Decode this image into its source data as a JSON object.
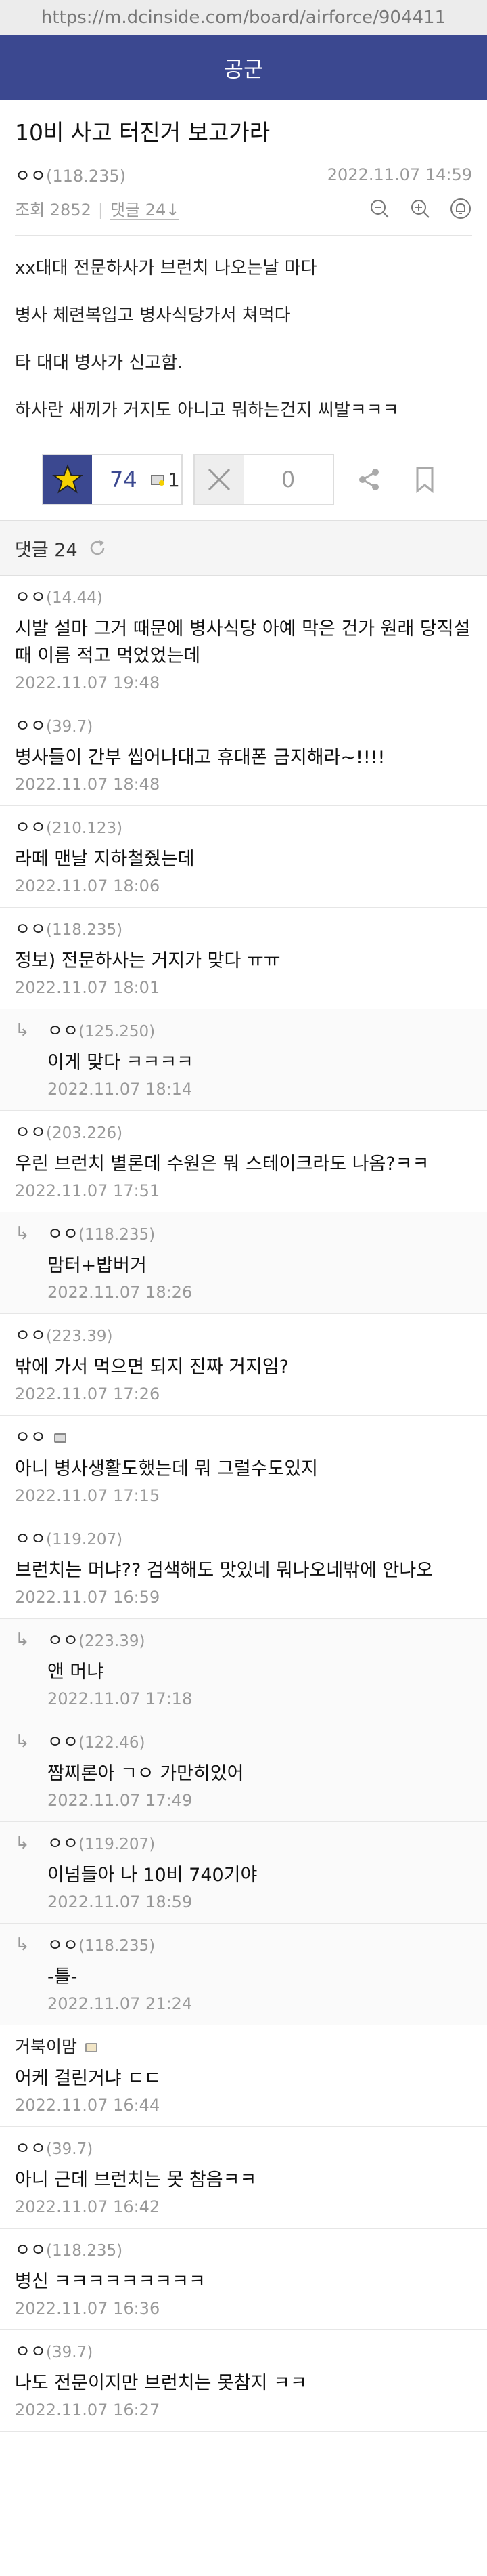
{
  "browser": {
    "url": "https://m.dcinside.com/board/airforce/904411"
  },
  "header": {
    "title": "공군"
  },
  "post": {
    "title": "10비 사고 터진거 보고가라",
    "author": "ㅇㅇ",
    "author_ip": "(118.235)",
    "datetime": "2022.11.07 14:59",
    "views": "조회 2852",
    "comments_link": "댓글 24",
    "body": [
      "xx대대 전문하사가 브런치 나오는날 마다",
      "병사 체련복입고 병사식당가서 쳐먹다",
      "타 대대 병사가 신고함.",
      "하사란 새끼가 거지도 아니고 뭐하는건지 씨발ㅋㅋㅋ"
    ],
    "upvotes": "74",
    "fixed_upvotes": "1",
    "downvotes": "0"
  },
  "comments_header": {
    "label": "댓글 24"
  },
  "comments": [
    {
      "reply": false,
      "author": "ㅇㅇ",
      "ip": "(14.44)",
      "text": "시발 설마 그거 때문에 병사식당 아예 막은 건가 원래 당직설 때 이름 적고 먹었었는데",
      "date": "2022.11.07 19:48"
    },
    {
      "reply": false,
      "author": "ㅇㅇ",
      "ip": "(39.7)",
      "text": "병사들이 간부 씹어나대고 휴대폰 금지해라~!!!!",
      "date": "2022.11.07 18:48"
    },
    {
      "reply": false,
      "author": "ㅇㅇ",
      "ip": "(210.123)",
      "text": "라떼 맨날 지하철줬는데",
      "date": "2022.11.07 18:06"
    },
    {
      "reply": false,
      "author": "ㅇㅇ",
      "ip": "(118.235)",
      "text": "정보) 전문하사는 거지가 맞다 ㅠㅠ",
      "date": "2022.11.07 18:01"
    },
    {
      "reply": true,
      "author": "ㅇㅇ",
      "ip": "(125.250)",
      "text": "이게 맞다 ㅋㅋㅋㅋ",
      "date": "2022.11.07 18:14"
    },
    {
      "reply": false,
      "author": "ㅇㅇ",
      "ip": "(203.226)",
      "text": "우린 브런치 별론데 수원은 뭐 스테이크라도 나옴?ㅋㅋ",
      "date": "2022.11.07 17:51"
    },
    {
      "reply": true,
      "author": "ㅇㅇ",
      "ip": "(118.235)",
      "text": "맘터+밥버거",
      "date": "2022.11.07 18:26"
    },
    {
      "reply": false,
      "author": "ㅇㅇ",
      "ip": "(223.39)",
      "text": "밖에 가서 먹으면 되지 진짜 거지임?",
      "date": "2022.11.07 17:26"
    },
    {
      "reply": false,
      "author": "ㅇㅇ",
      "ip": "",
      "badge": "fixed",
      "text": "아니 병사생활도했는데 뭐 그럴수도있지",
      "date": "2022.11.07 17:15"
    },
    {
      "reply": false,
      "author": "ㅇㅇ",
      "ip": "(119.207)",
      "text": "브런치는 머냐?? 검색해도 맛있네 뭐나오네밖에 안나오",
      "date": "2022.11.07 16:59"
    },
    {
      "reply": true,
      "author": "ㅇㅇ",
      "ip": "(223.39)",
      "text": "앤 머냐",
      "date": "2022.11.07 17:18"
    },
    {
      "reply": true,
      "author": "ㅇㅇ",
      "ip": "(122.46)",
      "text": "짬찌론아 ㄱㅇ 가만히있어",
      "date": "2022.11.07 17:49"
    },
    {
      "reply": true,
      "author": "ㅇㅇ",
      "ip": "(119.207)",
      "text": "이넘들아 나 10비 740기야",
      "date": "2022.11.07 18:59"
    },
    {
      "reply": true,
      "author": "ㅇㅇ",
      "ip": "(118.235)",
      "text": "-틀-",
      "date": "2022.11.07 21:24"
    },
    {
      "reply": false,
      "author": "거북이맘",
      "ip": "",
      "badge": "gall",
      "text": "어케 걸린거냐 ㄷㄷ",
      "date": "2022.11.07 16:44"
    },
    {
      "reply": false,
      "author": "ㅇㅇ",
      "ip": "(39.7)",
      "text": "아니 근데 브런치는 못 참음ㅋㅋ",
      "date": "2022.11.07 16:42"
    },
    {
      "reply": false,
      "author": "ㅇㅇ",
      "ip": "(118.235)",
      "text": "병신    ㅋㅋㅋㅋㅋㅋㅋㅋㅋ",
      "date": "2022.11.07 16:36"
    },
    {
      "reply": false,
      "author": "ㅇㅇ",
      "ip": "(39.7)",
      "text": "나도 전문이지만 브런치는 못참지 ㅋㅋ",
      "date": "2022.11.07 16:27"
    }
  ],
  "colors": {
    "header_bg": "#3b4890",
    "accent": "#3b4890"
  },
  "icons": [
    "zoom-out-icon",
    "zoom-in-icon",
    "notification-icon",
    "star-icon",
    "fixed-badge-icon",
    "x-icon",
    "share-icon",
    "bookmark-icon",
    "refresh-icon",
    "reply-arrow-icon"
  ]
}
